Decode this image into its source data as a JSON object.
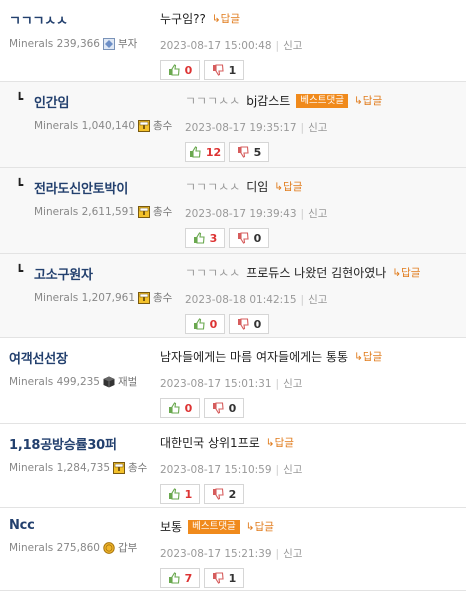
{
  "ui": {
    "reply_label": "↳답글",
    "report_label": "신고",
    "best_badge_label": "베스트댓글",
    "reply_marker": "┗"
  },
  "comments": [
    {
      "name": "ㄱㄱㄱㅅㅅ",
      "minerals": "Minerals 239,366",
      "rank": "부자",
      "rank_icon": "gem-icon",
      "mention": "",
      "text": "누구임??",
      "best": false,
      "date": "2023-08-17 15:00:48",
      "up": "0",
      "down": "1",
      "reply": false
    },
    {
      "name": "인간임",
      "minerals": "Minerals 1,040,140",
      "rank": "총수",
      "rank_icon": "chest-icon",
      "mention": "ㄱㄱㄱㅅㅅ",
      "text": "bj감스트",
      "best": true,
      "date": "2023-08-17 19:35:17",
      "up": "12",
      "down": "5",
      "reply": true
    },
    {
      "name": "전라도신안토박이",
      "minerals": "Minerals 2,611,591",
      "rank": "총수",
      "rank_icon": "chest-icon",
      "mention": "ㄱㄱㄱㅅㅅ",
      "text": "디임",
      "best": false,
      "date": "2023-08-17 19:39:43",
      "up": "3",
      "down": "0",
      "reply": true
    },
    {
      "name": "고소구원자",
      "minerals": "Minerals 1,207,961",
      "rank": "총수",
      "rank_icon": "chest-icon",
      "mention": "ㄱㄱㄱㅅㅅ",
      "text": "프로듀스 나왔던 김현아였나",
      "best": false,
      "date": "2023-08-18 01:42:15",
      "up": "0",
      "down": "0",
      "reply": true
    },
    {
      "name": "여객선선장",
      "minerals": "Minerals 499,235",
      "rank": "재벌",
      "rank_icon": "cube-icon",
      "mention": "",
      "text": "남자들에게는 마름 여자들에게는 통통",
      "best": false,
      "date": "2023-08-17 15:01:31",
      "up": "0",
      "down": "0",
      "reply": false
    },
    {
      "name": "1,18공방승률30퍼",
      "minerals": "Minerals 1,284,735",
      "rank": "총수",
      "rank_icon": "chest-icon",
      "mention": "",
      "text": "대한민국 상위1프로",
      "best": false,
      "date": "2023-08-17 15:10:59",
      "up": "1",
      "down": "2",
      "reply": false
    },
    {
      "name": "Ncc",
      "minerals": "Minerals 275,860",
      "rank": "갑부",
      "rank_icon": "coin-icon",
      "mention": "",
      "text": "보통",
      "best": true,
      "date": "2023-08-17 15:21:39",
      "up": "7",
      "down": "1",
      "reply": false
    }
  ]
}
